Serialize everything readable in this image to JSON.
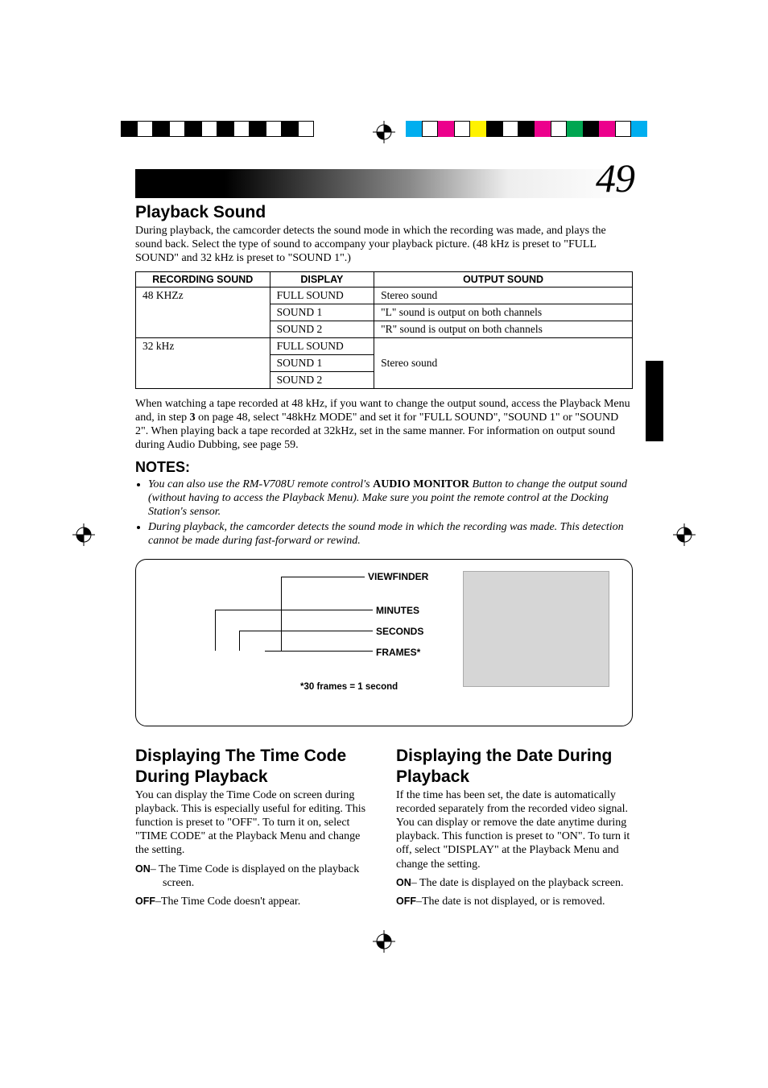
{
  "page_number": "49",
  "playback_sound": {
    "heading": "Playback Sound",
    "intro": "During playback, the camcorder detects the sound mode in which the recording was made, and plays the sound back. Select the type of sound to accompany your playback picture. (48 kHz is preset to \"FULL SOUND\" and 32 kHz is preset to \"SOUND 1\".)",
    "table": {
      "headers": {
        "rec": "RECORDING SOUND",
        "display": "DISPLAY",
        "output": "OUTPUT SOUND"
      },
      "group48": {
        "rec": "48 KHZz",
        "rows": [
          {
            "display": "FULL SOUND",
            "output": "Stereo sound"
          },
          {
            "display": "SOUND 1",
            "output": "\"L\" sound is output on both channels"
          },
          {
            "display": "SOUND 2",
            "output": "\"R\" sound is output on both channels"
          }
        ]
      },
      "group32": {
        "rec": "32 kHz",
        "rows": [
          {
            "display": "FULL SOUND"
          },
          {
            "display": "SOUND 1"
          },
          {
            "display": "SOUND 2"
          }
        ],
        "output_merged": "Stereo sound"
      }
    },
    "after_table_1": "When watching a tape recorded at 48 kHz, if you want to change the output sound, access the Playback Menu and, in step ",
    "after_table_step": "3",
    "after_table_2": " on page 48, select \"48kHz MODE\" and set it for \"FULL SOUND\", \"SOUND 1\" or \"SOUND 2\". When playing back a tape recorded at 32kHz, set in the same manner. For information on output sound during Audio Dubbing, see page 59."
  },
  "notes": {
    "heading": "NOTES:",
    "items": [
      {
        "pre": "You can also use the RM-V708U remote control's ",
        "bold": "AUDIO MONITOR",
        "post": " Button to change the output sound (without having to access the Playback Menu). Make sure you point the remote control at the Docking Station's sensor."
      },
      {
        "pre": "During playback, the camcorder detects the sound mode in which the recording was made. This detection cannot be made during fast-forward or rewind.",
        "bold": "",
        "post": ""
      }
    ]
  },
  "viewfinder_diagram": {
    "title": "VIEWFINDER",
    "labels": {
      "minutes": "MINUTES",
      "seconds": "SECONDS",
      "frames": "FRAMES*"
    },
    "footnote": "*30 frames = 1 second"
  },
  "timecode": {
    "heading": "Displaying The Time Code During Playback",
    "body": "You can display the Time Code on screen during playback. This is especially useful for editing. This function is preset to \"OFF\". To turn it on, select \"TIME CODE\" at the Playback Menu and change the setting.",
    "on_label": "ON",
    "on_text": "– The Time Code is displayed on the playback screen.",
    "off_label": "OFF",
    "off_text": "–The Time Code doesn't appear."
  },
  "date_display": {
    "heading": "Displaying the Date During Playback",
    "body": "If the time has been set, the date is automatically recorded separately from the recorded video signal. You can display or remove the date anytime during playback. This function is preset to \"ON\". To turn it off, select \"DISPLAY\" at the Playback Menu and change the setting.",
    "on_label": "ON",
    "on_text": "– The date is displayed on the playback screen.",
    "off_label": "OFF",
    "off_text": "–The date is not displayed, or is removed."
  },
  "reg_colors": {
    "left_top": [
      "#000",
      "#fff",
      "#000",
      "#fff",
      "#000",
      "#fff",
      "#000",
      "#fff",
      "#000",
      "#fff",
      "#000",
      "#fff"
    ],
    "right": [
      "#00aeef",
      "#ec008c",
      "#fff200",
      "#000",
      "#fff",
      "#000",
      "#ec008c",
      "#fff",
      "#00a651",
      "#000",
      "#ec008c",
      "#fff",
      "#00aeef"
    ]
  }
}
